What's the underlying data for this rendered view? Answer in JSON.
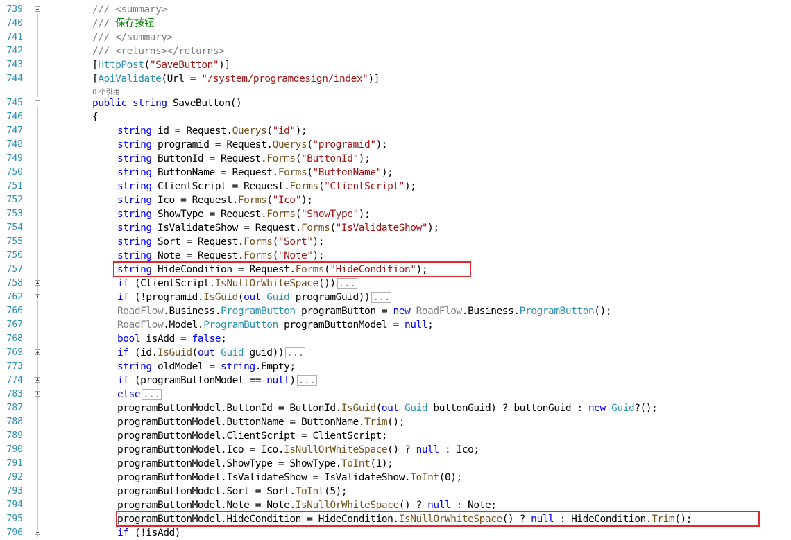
{
  "colors": {
    "keyword": "#0000ff",
    "type": "#2b91af",
    "string": "#a31515",
    "comment": "#808080",
    "line_number": "#2b91af",
    "highlight": "#e0282f"
  },
  "references_label": "0 个引用",
  "lines": [
    {
      "n": "739",
      "fold": "minus",
      "indent": 1,
      "tokens": [
        [
          "c",
          "/// <summary>"
        ]
      ]
    },
    {
      "n": "740",
      "indent": 1,
      "tokens": [
        [
          "c",
          "/// "
        ],
        [
          "cz",
          "保存按钮"
        ]
      ]
    },
    {
      "n": "741",
      "indent": 1,
      "tokens": [
        [
          "c",
          "/// </summary>"
        ]
      ]
    },
    {
      "n": "742",
      "indent": 1,
      "tokens": [
        [
          "c",
          "/// <returns></returns>"
        ]
      ]
    },
    {
      "n": "743",
      "indent": 1,
      "tokens": [
        [
          "",
          "["
        ],
        [
          "t",
          "HttpPost"
        ],
        [
          "",
          "("
        ],
        [
          "s",
          "\"SaveButton\""
        ],
        [
          "",
          ")]"
        ]
      ]
    },
    {
      "n": "744",
      "indent": 1,
      "tokens": [
        [
          "",
          "["
        ],
        [
          "t",
          "ApiValidate"
        ],
        [
          "",
          "(Url = "
        ],
        [
          "s",
          "\"/system/programdesign/index\""
        ],
        [
          "",
          ")]"
        ]
      ]
    },
    {
      "n": "745",
      "fold": "minus",
      "indent": 1,
      "tokens": [
        [
          "k",
          "public"
        ],
        [
          "",
          " "
        ],
        [
          "k",
          "string"
        ],
        [
          "",
          " SaveButton()"
        ]
      ]
    },
    {
      "n": "746",
      "indent": 1,
      "tokens": [
        [
          "",
          "{"
        ]
      ]
    },
    {
      "n": "747",
      "indent": 2,
      "tokens": [
        [
          "k",
          "string"
        ],
        [
          "",
          " id = Request."
        ],
        [
          "m",
          "Querys"
        ],
        [
          "",
          "("
        ],
        [
          "s",
          "\"id\""
        ],
        [
          "",
          ");"
        ]
      ]
    },
    {
      "n": "748",
      "indent": 2,
      "tokens": [
        [
          "k",
          "string"
        ],
        [
          "",
          " programid = Request."
        ],
        [
          "m",
          "Querys"
        ],
        [
          "",
          "("
        ],
        [
          "s",
          "\"programid\""
        ],
        [
          "",
          ");"
        ]
      ]
    },
    {
      "n": "749",
      "indent": 2,
      "tokens": [
        [
          "k",
          "string"
        ],
        [
          "",
          " ButtonId = Request."
        ],
        [
          "m",
          "Forms"
        ],
        [
          "",
          "("
        ],
        [
          "s",
          "\"ButtonId\""
        ],
        [
          "",
          ");"
        ]
      ]
    },
    {
      "n": "750",
      "indent": 2,
      "tokens": [
        [
          "k",
          "string"
        ],
        [
          "",
          " ButtonName = Request."
        ],
        [
          "m",
          "Forms"
        ],
        [
          "",
          "("
        ],
        [
          "s",
          "\"ButtonName\""
        ],
        [
          "",
          ");"
        ]
      ]
    },
    {
      "n": "751",
      "indent": 2,
      "tokens": [
        [
          "k",
          "string"
        ],
        [
          "",
          " ClientScript = Request."
        ],
        [
          "m",
          "Forms"
        ],
        [
          "",
          "("
        ],
        [
          "s",
          "\"ClientScript\""
        ],
        [
          "",
          ");"
        ]
      ]
    },
    {
      "n": "752",
      "indent": 2,
      "tokens": [
        [
          "k",
          "string"
        ],
        [
          "",
          " Ico = Request."
        ],
        [
          "m",
          "Forms"
        ],
        [
          "",
          "("
        ],
        [
          "s",
          "\"Ico\""
        ],
        [
          "",
          ");"
        ]
      ]
    },
    {
      "n": "753",
      "indent": 2,
      "tokens": [
        [
          "k",
          "string"
        ],
        [
          "",
          " ShowType = Request."
        ],
        [
          "m",
          "Forms"
        ],
        [
          "",
          "("
        ],
        [
          "s",
          "\"ShowType\""
        ],
        [
          "",
          ");"
        ]
      ]
    },
    {
      "n": "754",
      "indent": 2,
      "tokens": [
        [
          "k",
          "string"
        ],
        [
          "",
          " IsValidateShow = Request."
        ],
        [
          "m",
          "Forms"
        ],
        [
          "",
          "("
        ],
        [
          "s",
          "\"IsValidateShow\""
        ],
        [
          "",
          ");"
        ]
      ]
    },
    {
      "n": "755",
      "indent": 2,
      "tokens": [
        [
          "k",
          "string"
        ],
        [
          "",
          " Sort = Request."
        ],
        [
          "m",
          "Forms"
        ],
        [
          "",
          "("
        ],
        [
          "s",
          "\"Sort\""
        ],
        [
          "",
          ");"
        ]
      ]
    },
    {
      "n": "756",
      "indent": 2,
      "tokens": [
        [
          "k",
          "string"
        ],
        [
          "",
          " Note = Request."
        ],
        [
          "m",
          "Forms"
        ],
        [
          "",
          "("
        ],
        [
          "s",
          "\"Note\""
        ],
        [
          "",
          ");"
        ]
      ]
    },
    {
      "n": "757",
      "indent": 2,
      "hl": true,
      "tokens": [
        [
          "k",
          "string"
        ],
        [
          "",
          " HideCondition = Request."
        ],
        [
          "m",
          "Forms"
        ],
        [
          "",
          "("
        ],
        [
          "s",
          "\"HideCondition\""
        ],
        [
          "",
          ");"
        ]
      ]
    },
    {
      "n": "758",
      "fold": "plus",
      "indent": 2,
      "tokens": [
        [
          "k",
          "if"
        ],
        [
          "",
          " (ClientScript."
        ],
        [
          "m",
          "IsNullOrWhiteSpace"
        ],
        [
          "",
          "())"
        ],
        [
          "box",
          "..."
        ]
      ]
    },
    {
      "n": "762",
      "fold": "plus",
      "indent": 2,
      "tokens": [
        [
          "k",
          "if"
        ],
        [
          "",
          " (!programid."
        ],
        [
          "m",
          "IsGuid"
        ],
        [
          "",
          "("
        ],
        [
          "k",
          "out"
        ],
        [
          "",
          " "
        ],
        [
          "t",
          "Guid"
        ],
        [
          "",
          " programGuid))"
        ],
        [
          "box",
          "..."
        ]
      ]
    },
    {
      "n": "766",
      "indent": 2,
      "tokens": [
        [
          "c",
          "RoadFlow"
        ],
        [
          "",
          ".Business."
        ],
        [
          "t",
          "ProgramButton"
        ],
        [
          "",
          " programButton = "
        ],
        [
          "k",
          "new"
        ],
        [
          "",
          " "
        ],
        [
          "c",
          "RoadFlow"
        ],
        [
          "",
          ".Business."
        ],
        [
          "t",
          "ProgramButton"
        ],
        [
          "",
          "();"
        ]
      ]
    },
    {
      "n": "767",
      "indent": 2,
      "tokens": [
        [
          "c",
          "RoadFlow"
        ],
        [
          "",
          ".Model."
        ],
        [
          "t",
          "ProgramButton"
        ],
        [
          "",
          " programButtonModel = "
        ],
        [
          "k",
          "null"
        ],
        [
          "",
          ";"
        ]
      ]
    },
    {
      "n": "768",
      "indent": 2,
      "tokens": [
        [
          "k",
          "bool"
        ],
        [
          "",
          " isAdd = "
        ],
        [
          "k",
          "false"
        ],
        [
          "",
          ";"
        ]
      ]
    },
    {
      "n": "769",
      "fold": "plus",
      "indent": 2,
      "tokens": [
        [
          "k",
          "if"
        ],
        [
          "",
          " (id."
        ],
        [
          "m",
          "IsGuid"
        ],
        [
          "",
          "("
        ],
        [
          "k",
          "out"
        ],
        [
          "",
          " "
        ],
        [
          "t",
          "Guid"
        ],
        [
          "",
          " guid))"
        ],
        [
          "box",
          "..."
        ]
      ]
    },
    {
      "n": "773",
      "indent": 2,
      "tokens": [
        [
          "k",
          "string"
        ],
        [
          "",
          " oldModel = "
        ],
        [
          "k",
          "string"
        ],
        [
          "",
          ".Empty;"
        ]
      ]
    },
    {
      "n": "774",
      "fold": "plus",
      "indent": 2,
      "tokens": [
        [
          "k",
          "if"
        ],
        [
          "",
          " (programButtonModel == "
        ],
        [
          "k",
          "null"
        ],
        [
          "",
          ")"
        ],
        [
          "box",
          "..."
        ]
      ]
    },
    {
      "n": "783",
      "fold": "plus",
      "indent": 2,
      "tokens": [
        [
          "k",
          "else"
        ],
        [
          "box",
          "..."
        ]
      ]
    },
    {
      "n": "787",
      "indent": 2,
      "tokens": [
        [
          "",
          "programButtonModel.ButtonId = ButtonId."
        ],
        [
          "m",
          "IsGuid"
        ],
        [
          "",
          "("
        ],
        [
          "k",
          "out"
        ],
        [
          "",
          " "
        ],
        [
          "t",
          "Guid"
        ],
        [
          "",
          " buttonGuid) ? buttonGuid : "
        ],
        [
          "k",
          "new"
        ],
        [
          "",
          " "
        ],
        [
          "t",
          "Guid"
        ],
        [
          "",
          "?();"
        ]
      ]
    },
    {
      "n": "788",
      "indent": 2,
      "tokens": [
        [
          "",
          "programButtonModel.ButtonName = ButtonName."
        ],
        [
          "m",
          "Trim"
        ],
        [
          "",
          "();"
        ]
      ]
    },
    {
      "n": "789",
      "indent": 2,
      "tokens": [
        [
          "",
          "programButtonModel.ClientScript = ClientScript;"
        ]
      ]
    },
    {
      "n": "790",
      "indent": 2,
      "tokens": [
        [
          "",
          "programButtonModel.Ico = Ico."
        ],
        [
          "m",
          "IsNullOrWhiteSpace"
        ],
        [
          "",
          "() ? "
        ],
        [
          "k",
          "null"
        ],
        [
          "",
          " : Ico;"
        ]
      ]
    },
    {
      "n": "791",
      "indent": 2,
      "tokens": [
        [
          "",
          "programButtonModel.ShowType = ShowType."
        ],
        [
          "m",
          "ToInt"
        ],
        [
          "",
          "(1);"
        ]
      ]
    },
    {
      "n": "792",
      "indent": 2,
      "tokens": [
        [
          "",
          "programButtonModel.IsValidateShow = IsValidateShow."
        ],
        [
          "m",
          "ToInt"
        ],
        [
          "",
          "(0);"
        ]
      ]
    },
    {
      "n": "793",
      "indent": 2,
      "tokens": [
        [
          "",
          "programButtonModel.Sort = Sort."
        ],
        [
          "m",
          "ToInt"
        ],
        [
          "",
          "(5);"
        ]
      ]
    },
    {
      "n": "794",
      "indent": 2,
      "tokens": [
        [
          "",
          "programButtonModel.Note = Note."
        ],
        [
          "m",
          "IsNullOrWhiteSpace"
        ],
        [
          "",
          "() ? "
        ],
        [
          "k",
          "null"
        ],
        [
          "",
          " : Note;"
        ]
      ]
    },
    {
      "n": "795",
      "indent": 2,
      "hl": true,
      "tokens": [
        [
          "",
          "programButtonModel.HideCondition = HideCondition."
        ],
        [
          "m",
          "IsNullOrWhiteSpace"
        ],
        [
          "",
          "() ? "
        ],
        [
          "k",
          "null"
        ],
        [
          "",
          " : HideCondition."
        ],
        [
          "m",
          "Trim"
        ],
        [
          "",
          "();"
        ]
      ]
    },
    {
      "n": "796",
      "fold": "minus",
      "indent": 2,
      "tokens": [
        [
          "k",
          "if"
        ],
        [
          "",
          " (!isAdd)"
        ]
      ]
    }
  ]
}
